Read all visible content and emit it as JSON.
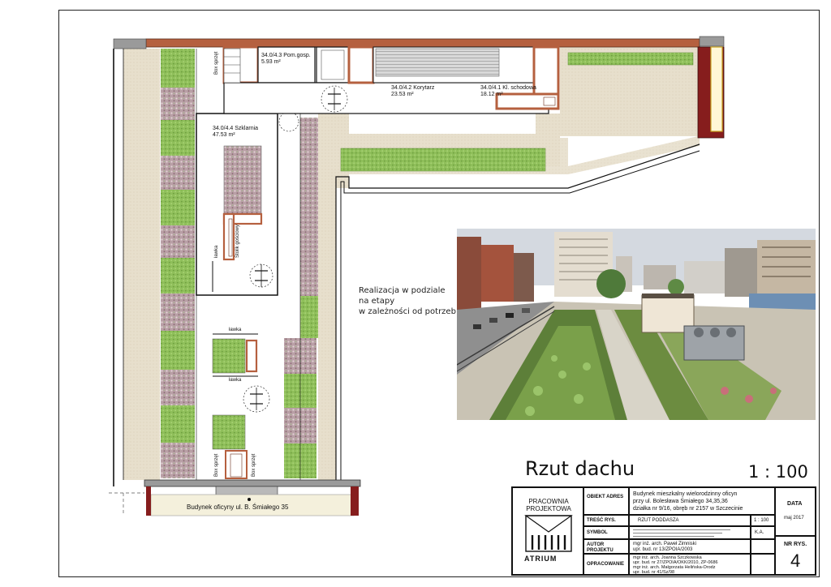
{
  "drawing": {
    "title": "Rzut dachu",
    "scale": "1 : 100",
    "note_lines": [
      "Realizacja w podziale",
      "na etapy",
      "w zależności od potrzeb"
    ],
    "neighbor_building": "Budynek oficyny ul. B. Śmiałego 35",
    "rooms": [
      {
        "code": "34.0/4.3",
        "name": "Pom.gosp.",
        "area": "5.93 m²"
      },
      {
        "code": "34.0/4.2",
        "name": "Korytarz",
        "area": "23.53 m²"
      },
      {
        "code": "34.0/4.1",
        "name": "Kl. schodowa",
        "area": "18.12 m²"
      },
      {
        "code": "34.0/4.4",
        "name": "Szklarnia",
        "area": "47.53 m²"
      }
    ],
    "furniture_labels": {
      "bench_1": "ławka",
      "bench_2": "ławka",
      "bench_3": "ławka",
      "table": "Stolik gościowy",
      "store_1": "Box sprzęt",
      "store_2": "Box sprzęt",
      "store_3": "Box sprzęt"
    },
    "colors": {
      "wall": "#b5603f",
      "terrace": "#e7dfcc",
      "grass": "#8fbf5a",
      "flowers": "#b99aa2",
      "frame": "#861d1d"
    }
  },
  "title_block": {
    "office": "PRACOWNIA PROJEKTOWA",
    "logo": "ATRIUM",
    "object_label": "OBIEKT ADRES",
    "object_value": [
      "Budynek mieszkalny wielorodzinny oficyn",
      "przy ul. Bolesława Śmiałego 34,35,36",
      "działka nr 9/16, obręb nr 2157 w Szczecinie"
    ],
    "data_label": "DATA",
    "data_value": "maj 2017",
    "content_label": "TREŚĆ RYS.",
    "content_value": "RZUT PODDASZA",
    "content_scale": "1 : 100",
    "symbol_label": "SYMBOL",
    "symbol_value": "K.A.",
    "author_label": "AUTOR PROJEKTU",
    "author_value": [
      "mgr inż. arch. Paweł Zimniski",
      "upr. bud. nr 13/ZPOIA/2003"
    ],
    "prep_label": "OPRACOWANIE",
    "prep_value": [
      "mgr inż. arch. Joanna Szczkowska",
      "upr. bud. nr 27/ZPOIA/OKK/2010, ZP-0686",
      "mgr inż. arch. Małgorzata Helińska-Orodz",
      "upr. bud. nr 41/Sz/98"
    ],
    "sheet_label": "NR RYS.",
    "sheet_value": "4"
  }
}
